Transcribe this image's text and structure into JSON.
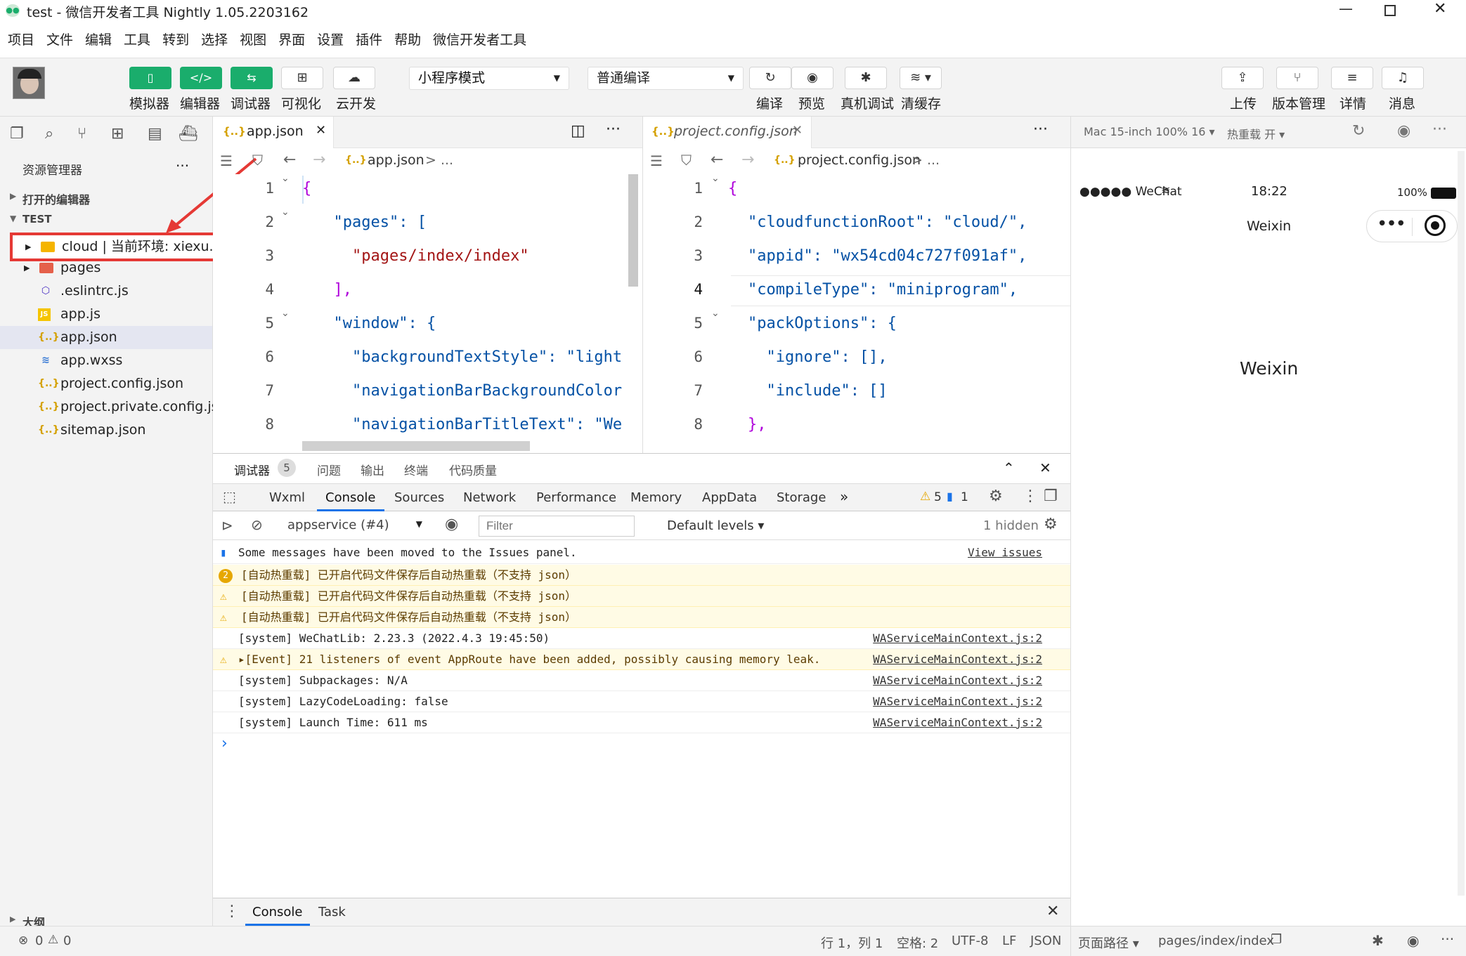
{
  "window": {
    "title": "test - 微信开发者工具 Nightly 1.05.2203162"
  },
  "menu": [
    "项目",
    "文件",
    "编辑",
    "工具",
    "转到",
    "选择",
    "视图",
    "界面",
    "设置",
    "插件",
    "帮助",
    "微信开发者工具"
  ],
  "toolbar": {
    "simulator": "模拟器",
    "editor": "编辑器",
    "debugger": "调试器",
    "visual": "可视化",
    "cloud": "云开发",
    "mode": "小程序模式",
    "compile_mode": "普通编译",
    "compile": "编译",
    "preview": "预览",
    "remote_debug": "真机调试",
    "clear_cache": "清缓存",
    "upload": "上传",
    "version": "版本管理",
    "details": "详情",
    "messages": "消息"
  },
  "explorer": {
    "title": "资源管理器",
    "open_editors": "打开的编辑器",
    "project": "TEST",
    "files": [
      {
        "name": "cloud | 当前环境: xiexu...",
        "icon": "folder-icon"
      },
      {
        "name": "pages",
        "icon": "folder-icon"
      },
      {
        "name": ".eslintrc.js",
        "icon": "eslint-icon"
      },
      {
        "name": "app.js",
        "icon": "js-icon"
      },
      {
        "name": "app.json",
        "icon": "json-icon"
      },
      {
        "name": "app.wxss",
        "icon": "css-icon"
      },
      {
        "name": "project.config.json",
        "icon": "json-icon"
      },
      {
        "name": "project.private.config.js...",
        "icon": "json-icon"
      },
      {
        "name": "sitemap.json",
        "icon": "json-icon"
      }
    ],
    "outline": "大纲",
    "errors": "0",
    "warnings": "0"
  },
  "editor1": {
    "tab": "app.json",
    "crumb": "app.json",
    "crumb_rest": "> ...",
    "lines": [
      "1",
      "2",
      "3",
      "4",
      "5",
      "6",
      "7",
      "8"
    ],
    "code": [
      "{",
      "  \"pages\": [",
      "    \"pages/index/index\"",
      "  ],",
      "  \"window\": {",
      "    \"backgroundTextStyle\": \"light",
      "    \"navigationBarBackgroundColor",
      "    \"navigationBarTitleText\": \"We"
    ]
  },
  "editor2": {
    "tab": "project.config.json",
    "crumb": "project.config.json",
    "crumb_rest": "> ...",
    "lines": [
      "1",
      "2",
      "3",
      "4",
      "5",
      "6",
      "7",
      "8"
    ],
    "code": [
      "{",
      "\"cloudfunctionRoot\": \"cloud/\",",
      "\"appid\": \"wx54cd04c727f091af\",",
      "\"compileType\": \"miniprogram\",",
      "\"packOptions\": {",
      "  \"ignore\": [],",
      "  \"include\": []",
      "},"
    ]
  },
  "devtools": {
    "panel_tabs": [
      "调试器",
      "问题",
      "输出",
      "终端",
      "代码质量"
    ],
    "badge": "5",
    "tabs": [
      "Wxml",
      "Console",
      "Sources",
      "Network",
      "Performance",
      "Memory",
      "AppData",
      "Storage"
    ],
    "warn_count": "5",
    "info_count": "1",
    "context": "appservice (#4)",
    "filter_placeholder": "Filter",
    "levels": "Default levels ▾",
    "hidden": "1 hidden",
    "logs": [
      {
        "text": "Some messages have been moved to the Issues panel.",
        "link": "View issues",
        "type": "info"
      },
      {
        "text": "[自动热重载] 已开启代码文件保存后自动热重载（不支持 json）",
        "link": "",
        "type": "warn-count"
      },
      {
        "text": "[自动热重载] 已开启代码文件保存后自动热重载（不支持 json）",
        "link": "",
        "type": "warn"
      },
      {
        "text": "[自动热重载] 已开启代码文件保存后自动热重载（不支持 json）",
        "link": "",
        "type": "warn"
      },
      {
        "text": "[system] WeChatLib: 2.23.3 (2022.4.3 19:45:50)",
        "link": "WAServiceMainContext.js:2",
        "type": "log"
      },
      {
        "text": "▸[Event] 21 listeners of event AppRoute have been added, possibly causing memory leak.",
        "link": "WAServiceMainContext.js:2",
        "type": "warn"
      },
      {
        "text": "[system] Subpackages: N/A",
        "link": "WAServiceMainContext.js:2",
        "type": "log"
      },
      {
        "text": "[system] LazyCodeLoading: false",
        "link": "WAServiceMainContext.js:2",
        "type": "log"
      },
      {
        "text": "[system] Launch Time: 611 ms",
        "link": "WAServiceMainContext.js:2",
        "type": "log"
      }
    ],
    "prompt": "›",
    "drawer_tabs": [
      "Console",
      "Task"
    ]
  },
  "simulator": {
    "device": "Mac 15-inch 100% 16 ▾",
    "hot_reload": "热重载 开 ▾",
    "carrier": "●●●●● WeChat",
    "time": "18:22",
    "battery": "100%",
    "nav_title": "Weixin",
    "body_text": "Weixin",
    "page_path_label": "页面路径 ▾",
    "page_path": "pages/index/index"
  },
  "statusbar": {
    "position": "行 1，列 1",
    "spaces": "空格: 2",
    "encoding": "UTF-8",
    "eol": "LF",
    "lang": "JSON"
  }
}
